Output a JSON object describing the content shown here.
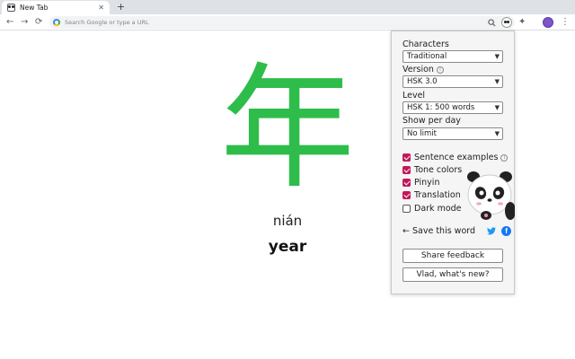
{
  "browser": {
    "tab_title": "New Tab",
    "tab_close": "✕",
    "new_tab": "+",
    "omnibox_placeholder": "Search Google or type a URL",
    "icons": [
      "panda-favicon-icon",
      "close-icon",
      "plus-icon",
      "back-icon",
      "forward-icon",
      "reload-icon",
      "google-icon",
      "search-icon",
      "star-icon",
      "panda-extension-icon",
      "puzzle-icon",
      "profile-icon",
      "kebab-menu-icon"
    ]
  },
  "card": {
    "character": "年",
    "pinyin": "nián",
    "translation": "year",
    "character_color": "#2ebd4b"
  },
  "popup": {
    "characters_label": "Characters",
    "characters_value": "Traditional",
    "version_label": "Version",
    "version_value": "HSK 3.0",
    "level_label": "Level",
    "level_value": "HSK 1: 500 words",
    "show_per_day_label": "Show per day",
    "show_per_day_value": "No limit",
    "options": [
      {
        "label": "Sentence examples",
        "checked": true
      },
      {
        "label": "Tone colors",
        "checked": true
      },
      {
        "label": "Pinyin",
        "checked": true
      },
      {
        "label": "Translation",
        "checked": true
      },
      {
        "label": "Dark mode",
        "checked": false
      }
    ],
    "save_word": "← Save this word",
    "share_feedback": "Share feedback",
    "whats_new": "Vlad, what's new?",
    "accent_color": "#c2185b"
  }
}
